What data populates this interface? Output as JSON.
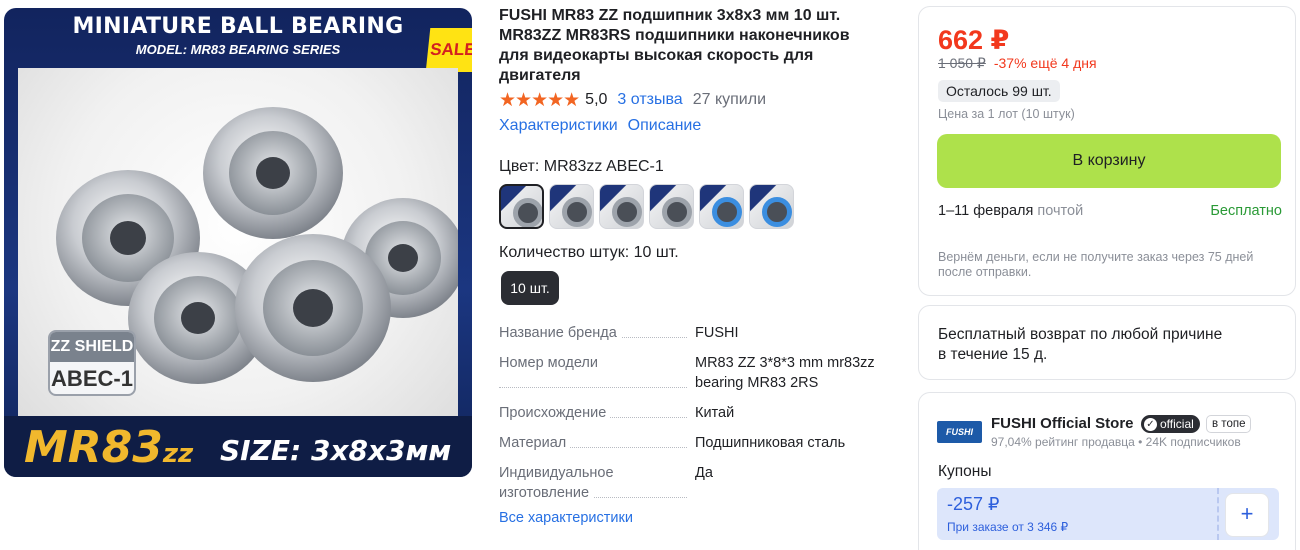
{
  "hero": {
    "banner_title": "MINIATURE BALL BEARING",
    "banner_subtitle": "MODEL:   MR83 BEARING SERIES",
    "sale": "SALE",
    "shield_line1": "ZZ SHIELD",
    "shield_line2": "ABEC-1",
    "model_main": "MR83",
    "model_suffix": "zz",
    "size": "SIZE: 3x8x3мм"
  },
  "product": {
    "title": "FUSHI MR83 ZZ подшипник 3x8x3 мм 10 шт. MR83ZZ MR83RS подшипники наконечников для видеокарты высокая скорость для двигателя",
    "stars": "★★★★★",
    "rating": "5,0",
    "reviews": "3 отзыва",
    "bought": "27 купили",
    "link_specs": "Характеристики",
    "link_desc": "Описание",
    "color_label": "Цвет: MR83zz ABEC-1",
    "qty_label": "Количество штук: 10 шт.",
    "qty_option": "10 шт.",
    "specs": [
      {
        "k": "Название бренда",
        "v": "FUSHI"
      },
      {
        "k": "Номер модели",
        "v": "MR83 ZZ 3*8*3 mm mr83zz bearing MR83 2RS"
      },
      {
        "k": "Происхождение",
        "v": "Китай"
      },
      {
        "k": "Материал",
        "v": "Подшипниковая сталь"
      },
      {
        "k": "Индивидуальное изготовление",
        "v": "Да"
      }
    ],
    "all_specs": "Все характеристики"
  },
  "buy": {
    "price": "662 ₽",
    "old_price": "1 050 ₽",
    "discount": "-37% ещё 4 дня",
    "stock": "Осталось 99 шт.",
    "lot": "Цена за 1 лот (10 штук)",
    "cart": "В корзину",
    "delivery_dates": "1–11 февраля",
    "delivery_method": "почтой",
    "delivery_price": "Бесплатно",
    "refund": "Вернём деньги, если не получите заказ через 75 дней после отправки."
  },
  "returns": {
    "text": "Бесплатный возврат по любой причине",
    "text2": "в течение 15 д."
  },
  "store": {
    "logo": "FUSHI",
    "name": "FUSHI Official Store",
    "official": "official",
    "top": "в топе",
    "meta": "97,04% рейтинг продавца  •  24K подписчиков",
    "coupons_label": "Купоны",
    "coupon_amount": "-257 ₽",
    "coupon_cond": "При заказе от 3 346 ₽",
    "add": "+"
  },
  "colors": {
    "accent_red": "#f2381d",
    "link_blue": "#2770e3",
    "cart_green": "#aee14b",
    "star_orange": "#f26522"
  }
}
